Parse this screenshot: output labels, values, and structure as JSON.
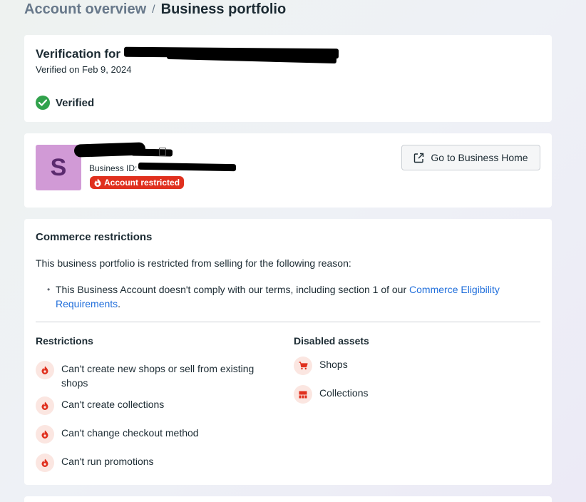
{
  "breadcrumb": {
    "parent": "Account overview",
    "separator": "/",
    "current": "Business portfolio"
  },
  "verification": {
    "title_prefix": "Verification for",
    "date": "Verified on Feb 9, 2024",
    "status": "Verified"
  },
  "business": {
    "avatar_letter": "S",
    "id_label": "Business ID:",
    "badge": "Account restricted",
    "home_button": "Go to Business Home"
  },
  "commerce": {
    "title": "Commerce restrictions",
    "intro": "This business portfolio is restricted from selling for the following reason:",
    "reason_text": "This Business Account doesn't comply with our terms, including section 1 of our ",
    "reason_link": "Commerce Eligibility Requirements",
    "reason_end": ".",
    "restrictions_title": "Restrictions",
    "restrictions": [
      "Can't create new shops or sell from existing shops",
      "Can't create collections",
      "Can't change checkout method",
      "Can't run promotions"
    ],
    "assets_title": "Disabled assets",
    "assets": [
      "Shops",
      "Collections"
    ]
  },
  "colors": {
    "accent_red": "#e0301e",
    "verified_green": "#31a24c",
    "link_blue": "#216fdb"
  }
}
